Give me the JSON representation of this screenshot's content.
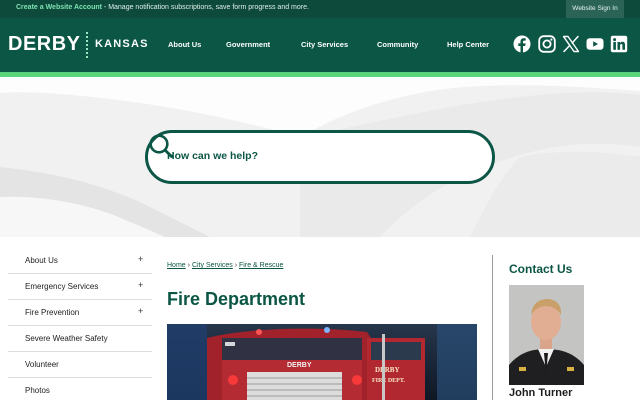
{
  "topbar": {
    "create_account": "Create a Website Account",
    "message": " - Manage notification subscriptions, save form progress and more.",
    "sign_in": "Website Sign In"
  },
  "logo": {
    "city": "DERBY",
    "state": "KANSAS"
  },
  "nav": [
    {
      "label": "About Us"
    },
    {
      "label": "Government"
    },
    {
      "label": "City Services"
    },
    {
      "label": "Community"
    },
    {
      "label": "Help Center"
    }
  ],
  "social": [
    "facebook-icon",
    "instagram-icon",
    "x-icon",
    "youtube-icon",
    "linkedin-icon"
  ],
  "search": {
    "placeholder": "How can we help?"
  },
  "sidebar": {
    "items": [
      {
        "label": "About Us",
        "expand": "+"
      },
      {
        "label": "Emergency Services",
        "expand": "+"
      },
      {
        "label": "Fire Prevention",
        "expand": "+"
      },
      {
        "label": "Severe Weather Safety",
        "expand": ""
      },
      {
        "label": "Volunteer",
        "expand": ""
      },
      {
        "label": "Photos",
        "expand": ""
      }
    ]
  },
  "breadcrumb": {
    "home": "Home",
    "city_services": "City Services",
    "fire_rescue": "Fire & Rescue",
    "separator": "›"
  },
  "page": {
    "title": "Fire Department"
  },
  "photo": {
    "truck_text": "DERBY",
    "door_text_1": "DERBY",
    "door_text_2": "FIRE DEPT."
  },
  "contact": {
    "title": "Contact Us",
    "name": "John Turner"
  },
  "colors": {
    "brand_dark": "#0b5645",
    "topbar": "#0e4a3c",
    "accent_green": "#59d47b"
  }
}
